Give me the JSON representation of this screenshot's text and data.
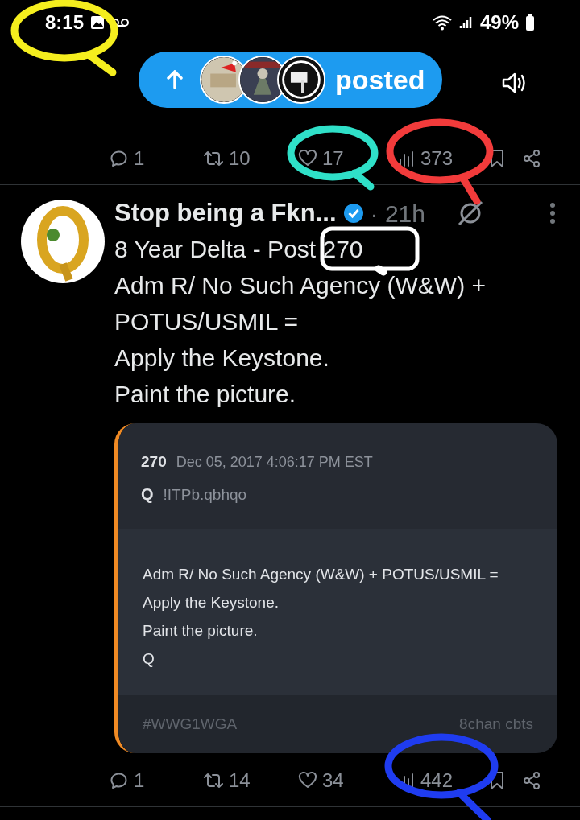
{
  "status_bar": {
    "time": "8:15",
    "battery": "49%"
  },
  "new_posts_pill": {
    "label": "posted"
  },
  "top_post_actions": {
    "replies": "1",
    "reposts": "10",
    "likes": "17",
    "views": "373"
  },
  "post": {
    "author": "Stop being a Fkn...",
    "verified": true,
    "time": "· 21h",
    "lines": [
      "8 Year Delta - Post 270",
      "Adm R/ No Such Agency (W&W) + POTUS/USMIL =",
      "Apply the Keystone.",
      "Paint the picture."
    ],
    "card": {
      "number": "270",
      "date": "Dec 05, 2017 4:06:17 PM EST",
      "name": "Q",
      "tripcode": "!ITPb.qbhqo",
      "lines": [
        "Adm R/ No Such Agency (W&W) + POTUS/USMIL =",
        "Apply the Keystone.",
        "Paint the picture.",
        "Q"
      ],
      "tag": "#WWG1WGA",
      "source": "8chan cbts"
    },
    "actions": {
      "replies": "1",
      "reposts": "14",
      "likes": "34",
      "views": "442"
    }
  },
  "annotations": [
    {
      "color": "#f5ee1e"
    },
    {
      "color": "#2fe0c8"
    },
    {
      "color": "#f23b3b"
    },
    {
      "color": "#ffffff"
    },
    {
      "color": "#1f3cf0"
    }
  ]
}
